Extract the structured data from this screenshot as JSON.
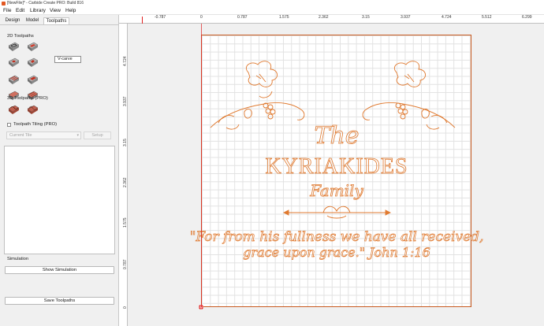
{
  "window": {
    "title": "[NewFile]* - Carbide Create PRO: Build 816"
  },
  "menu": [
    {
      "label": "File"
    },
    {
      "label": "Edit"
    },
    {
      "label": "Library"
    },
    {
      "label": "View"
    },
    {
      "label": "Help"
    }
  ],
  "tabs": [
    {
      "label": "Design",
      "active": false
    },
    {
      "label": "Model",
      "active": false
    },
    {
      "label": "Toolpaths",
      "active": true
    }
  ],
  "toolpaths_2d": {
    "heading": "2D Toolpaths",
    "tooltip": "V-carve",
    "icons": [
      "contour-toolpath",
      "pocket-toolpath",
      "drill-toolpath",
      "vcarve-toolpath",
      "texture-toolpath",
      "advanced-vcarve-toolpath",
      "rough-toolpath",
      "finish-toolpath"
    ]
  },
  "toolpaths_3d": {
    "heading": "3D Toolpaths (PRO)",
    "icons": [
      "3d-rough-toolpath",
      "3d-finish-toolpath"
    ]
  },
  "tiling": {
    "label": "Toolpath Tiling (PRO)",
    "checked": false,
    "tile_select": "Current Tile",
    "setup_label": "Setup"
  },
  "simulation": {
    "heading": "Simulation",
    "show_label": "Show Simulation",
    "save_label": "Save Toolpaths"
  },
  "rulers": {
    "top": [
      "-0.787",
      "0",
      "0.787",
      "1.575",
      "2.362",
      "3.15",
      "3.937",
      "4.724",
      "5.512",
      "6.299"
    ],
    "left": [
      "4.724",
      "3.937",
      "3.15",
      "2.362",
      "1.575",
      "0.787",
      "0"
    ]
  },
  "design": {
    "line1": "The",
    "line2": "KYRIAKIDES",
    "line3": "Family",
    "quote1": "\"For from his fullness we have all received,",
    "quote2": "grace upon grace.\" John 1:16",
    "stroke_color": "#e07a30"
  }
}
